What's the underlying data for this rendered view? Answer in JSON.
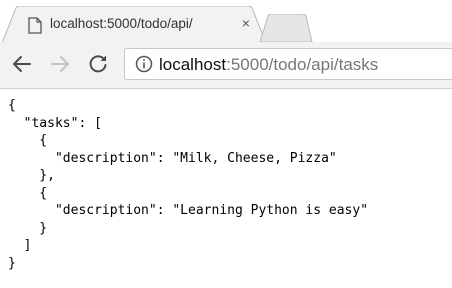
{
  "tab": {
    "title": "localhost:5000/todo/api/",
    "close_glyph": "×",
    "icon": "document-icon"
  },
  "toolbar": {
    "back_icon": "back-arrow-icon",
    "forward_icon": "forward-arrow-icon",
    "reload_icon": "reload-icon",
    "info_icon": "info-icon",
    "url_host": "localhost",
    "url_rest": ":5000/todo/api/tasks"
  },
  "response": {
    "lines": [
      "{",
      "  \"tasks\": [",
      "    {",
      "      \"description\": \"Milk, Cheese, Pizza\"",
      "    },",
      "    {",
      "      \"description\": \"Learning Python is easy\"",
      "    }",
      "  ]",
      "}"
    ]
  },
  "colors": {
    "toolbar_bg": "#f2f2f2",
    "tab_border": "#b9b9b9",
    "new_tab_bg": "#e6e6e6"
  }
}
